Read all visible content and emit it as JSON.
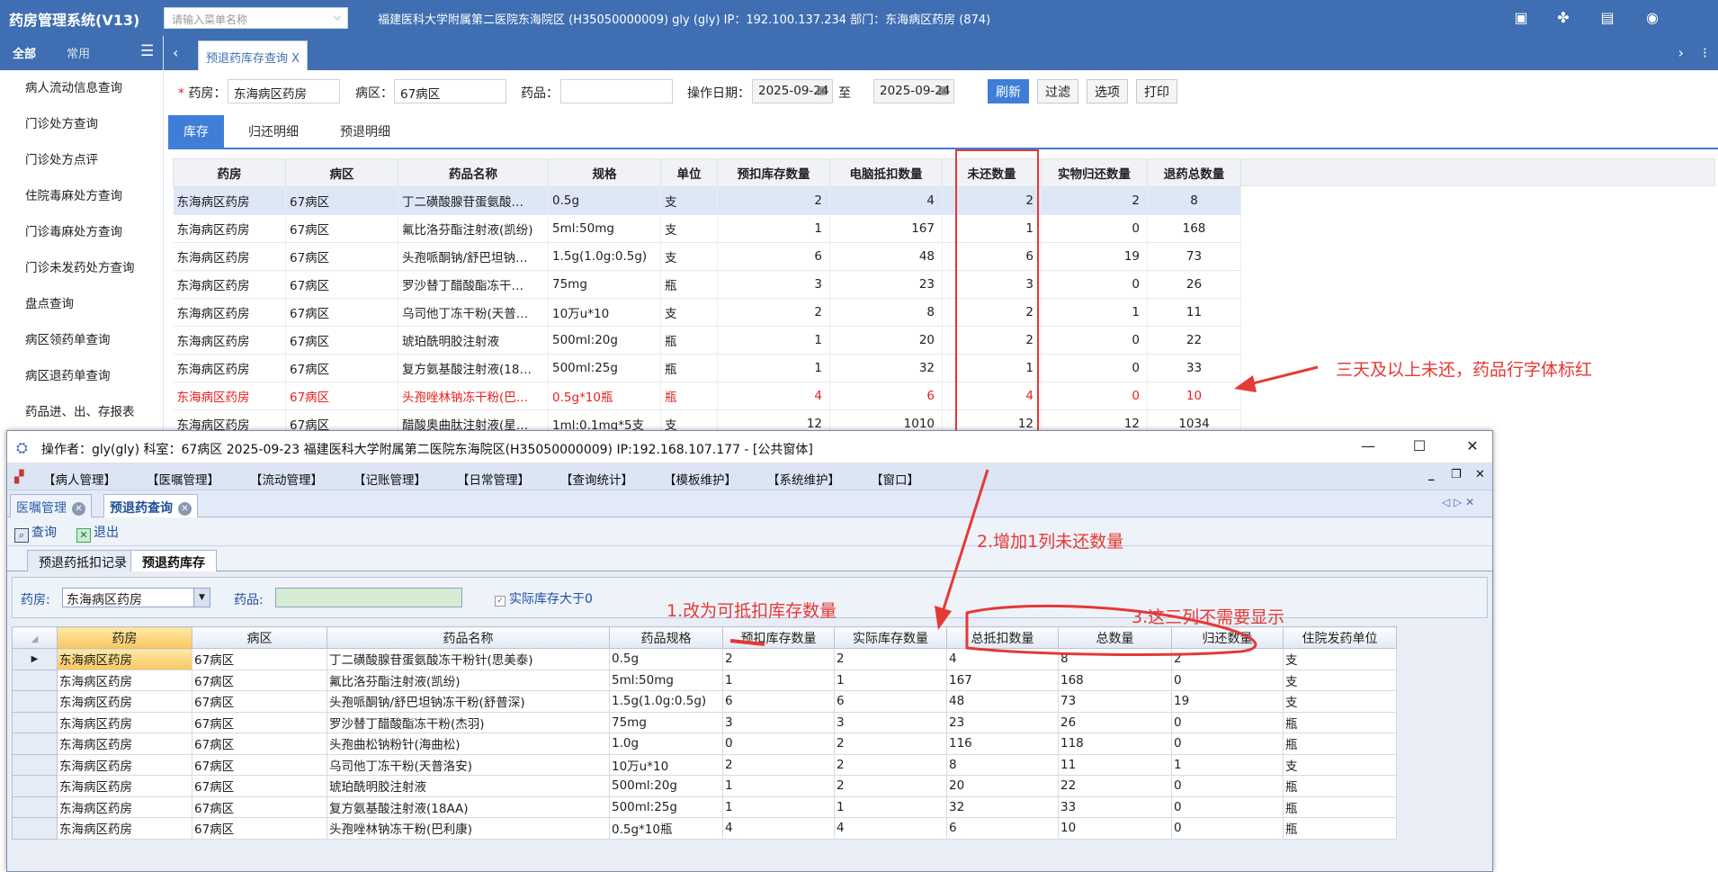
{
  "app": {
    "brand": "药房管理系统(V13)",
    "menu_search_placeholder": "请输入菜单名称",
    "org_info": "福建医科大学附属第二医院东海院区 (H35050000009) gly (gly) IP：192.100.137.234 部门：东海病区药房 (874)",
    "tool_icons": [
      "screen-icon",
      "settings-icon",
      "clipboard-icon",
      "eye-icon"
    ]
  },
  "leftnav": {
    "tab_all": "全部",
    "tab_common": "常用",
    "items": [
      "病人流动信息查询",
      "门诊处方查询",
      "门诊处方点评",
      "住院毒麻处方查询",
      "门诊毒麻处方查询",
      "门诊未发药处方查询",
      "盘点查询",
      "病区领药单查询",
      "病区退药单查询",
      "药品进、出、存报表"
    ]
  },
  "tabs": {
    "active": "预退药库存查询 X"
  },
  "filters": {
    "pharmacy_label": "药房：",
    "pharmacy_value": "东海病区药房",
    "ward_label": "病区：",
    "ward_value": "67病区",
    "drug_label": "药品：",
    "drug_value": "",
    "date_label": "操作日期：",
    "date_from": "2025-09-24",
    "date_to_label": "至",
    "date_to": "2025-09-24",
    "btn_refresh": "刷新",
    "btn_filter": "过滤",
    "btn_options": "选项",
    "btn_print": "打印"
  },
  "subtabs": [
    "库存",
    "归还明细",
    "预退明细"
  ],
  "web_table": {
    "headers": [
      "药房",
      "病区",
      "药品名称",
      "规格",
      "单位",
      "预扣库存数量",
      "电脑抵扣数量",
      "未还数量",
      "实物归还数量",
      "退药总数量"
    ],
    "rows": [
      [
        "东海病区药房",
        "67病区",
        "丁二磺酸腺苷蛋氨酸…",
        "0.5g",
        "支",
        "2",
        "4",
        "2",
        "2",
        "8"
      ],
      [
        "东海病区药房",
        "67病区",
        "氟比洛芬酯注射液(凯纷)",
        "5ml:50mg",
        "支",
        "1",
        "167",
        "1",
        "0",
        "168"
      ],
      [
        "东海病区药房",
        "67病区",
        "头孢哌酮钠/舒巴坦钠…",
        "1.5g(1.0g:0.5g)",
        "支",
        "6",
        "48",
        "6",
        "19",
        "73"
      ],
      [
        "东海病区药房",
        "67病区",
        "罗沙替丁醋酸酯冻干…",
        "75mg",
        "瓶",
        "3",
        "23",
        "3",
        "0",
        "26"
      ],
      [
        "东海病区药房",
        "67病区",
        "乌司他丁冻干粉(天普…",
        "10万u*10",
        "支",
        "2",
        "8",
        "2",
        "1",
        "11"
      ],
      [
        "东海病区药房",
        "67病区",
        "琥珀酰明胶注射液",
        "500ml:20g",
        "瓶",
        "1",
        "20",
        "2",
        "0",
        "22"
      ],
      [
        "东海病区药房",
        "67病区",
        "复方氨基酸注射液(18…",
        "500ml:25g",
        "瓶",
        "1",
        "32",
        "1",
        "0",
        "33"
      ],
      [
        "东海病区药房",
        "67病区",
        "头孢唑林钠冻干粉(巴…",
        "0.5g*10瓶",
        "瓶",
        "4",
        "6",
        "4",
        "0",
        "10"
      ],
      [
        "东海病区药房",
        "67病区",
        "醋酸奥曲肽注射液(星…",
        "1ml:0.1mg*5支",
        "支",
        "12",
        "1010",
        "12",
        "12",
        "1034"
      ]
    ],
    "highlight_row": 0,
    "red_row": 7
  },
  "annotations": {
    "red_rule": "三天及以上未还，药品行字体标红",
    "add_column": "2.增加1列未还数量",
    "rename": "1.改为可抵扣库存数量",
    "hide_three": "3.这三列不需要显示",
    "color": "#e53935"
  },
  "window": {
    "title": "操作者：gly(gly)  科室：67病区  2025-09-23  福建医科大学附属第二医院东海院区(H35050000009) IP:192.168.107.177 - [公共窗体]",
    "menus": [
      "【病人管理】",
      "【医嘱管理】",
      "【流动管理】",
      "【记账管理】",
      "【日常管理】",
      "【查询统计】",
      "【模板维护】",
      "【系统维护】",
      "【窗口】"
    ],
    "doc_tabs": [
      "医嘱管理",
      "预退药查询"
    ],
    "toolbar": {
      "query": "查询",
      "exit": "退出"
    },
    "inner_tabs": [
      "预退药抵扣记录",
      "预退药库存"
    ],
    "filter": {
      "pharmacy_label": "药房:",
      "pharmacy_value": "东海病区药房",
      "drug_label": "药品:",
      "checkbox_label": "实际库存大于0"
    },
    "table": {
      "headers": [
        "药房",
        "病区",
        "药品名称",
        "药品规格",
        "预扣库存数量",
        "实际库存数量",
        "总抵扣数量",
        "总数量",
        "归还数量",
        "住院发药单位"
      ],
      "rows": [
        [
          "东海病区药房",
          "67病区",
          "丁二磺酸腺苷蛋氨酸冻干粉针(思美泰)",
          "0.5g",
          "2",
          "2",
          "4",
          "8",
          "2",
          "支"
        ],
        [
          "东海病区药房",
          "67病区",
          "氟比洛芬酯注射液(凯纷)",
          "5ml:50mg",
          "1",
          "1",
          "167",
          "168",
          "0",
          "支"
        ],
        [
          "东海病区药房",
          "67病区",
          "头孢哌酮钠/舒巴坦钠冻干粉(舒普深)",
          "1.5g(1.0g:0.5g)",
          "6",
          "6",
          "48",
          "73",
          "19",
          "支"
        ],
        [
          "东海病区药房",
          "67病区",
          "罗沙替丁醋酸酯冻干粉(杰羽)",
          "75mg",
          "3",
          "3",
          "23",
          "26",
          "0",
          "瓶"
        ],
        [
          "东海病区药房",
          "67病区",
          "头孢曲松钠粉针(海曲松)",
          "1.0g",
          "0",
          "2",
          "116",
          "118",
          "0",
          "瓶"
        ],
        [
          "东海病区药房",
          "67病区",
          "乌司他丁冻干粉(天普洛安)",
          "10万u*10",
          "2",
          "2",
          "8",
          "11",
          "1",
          "支"
        ],
        [
          "东海病区药房",
          "67病区",
          "琥珀酰明胶注射液",
          "500ml:20g",
          "1",
          "2",
          "20",
          "22",
          "0",
          "瓶"
        ],
        [
          "东海病区药房",
          "67病区",
          "复方氨基酸注射液(18AA)",
          "500ml:25g",
          "1",
          "1",
          "32",
          "33",
          "0",
          "瓶"
        ],
        [
          "东海病区药房",
          "67病区",
          "头孢唑林钠冻干粉(巴利康)",
          "0.5g*10瓶",
          "4",
          "4",
          "6",
          "10",
          "0",
          "瓶"
        ]
      ]
    }
  }
}
